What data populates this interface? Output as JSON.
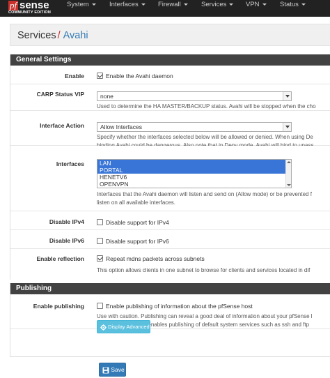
{
  "brand": {
    "logo_pf": "pf",
    "logo_sense": "sense",
    "edition": "COMMUNITY EDITION"
  },
  "nav": {
    "items": [
      {
        "label": "System"
      },
      {
        "label": "Interfaces"
      },
      {
        "label": "Firewall"
      },
      {
        "label": "Services"
      },
      {
        "label": "VPN"
      },
      {
        "label": "Status"
      }
    ]
  },
  "breadcrumb": {
    "parent": "Services",
    "separator": "/",
    "current": "Avahi"
  },
  "general": {
    "heading": "General Settings",
    "enable": {
      "label": "Enable",
      "text": "Enable the Avahi daemon",
      "checked": true
    },
    "carp": {
      "label": "CARP Status VIP",
      "value": "none",
      "help": "Used to determine the HA MASTER/BACKUP status. Avahi will be stopped when the cho"
    },
    "interface_action": {
      "label": "Interface Action",
      "value": "Allow Interfaces",
      "help1": "Specify whether the interfaces selected below will be allowed or denied. When using De",
      "help2": "binding Avahi could be dangerous. Also note that in Deny mode, Avahi will bind to unass"
    },
    "interfaces": {
      "label": "Interfaces",
      "options": [
        {
          "label": "LAN",
          "selected": true
        },
        {
          "label": "PORTAL",
          "selected": true
        },
        {
          "label": "HENETV6",
          "selected": false
        },
        {
          "label": "OPENVPN",
          "selected": false
        }
      ],
      "help1": "Interfaces that the Avahi daemon will listen and send on (Allow mode) or be prevented f",
      "help2": "listen on all available interfaces."
    },
    "disable_ipv4": {
      "label": "Disable IPv4",
      "text": "Disable support for IPv4",
      "checked": false
    },
    "disable_ipv6": {
      "label": "Disable IPv6",
      "text": "Disable support for IPv6",
      "checked": false
    },
    "reflection": {
      "label": "Enable reflection",
      "text": "Repeat mdns packets across subnets",
      "checked": true,
      "help": "This option allows clients in one subnet to browse for clients and services located in dif"
    }
  },
  "publishing": {
    "heading": "Publishing",
    "enable_publishing": {
      "label": "Enable publishing",
      "text": "Enable publishing of information about the pfSense host",
      "checked": false,
      "help1": "Use with caution. Publishing can reveal a good deal of information about your pfSense l",
      "help2": "Note that this option enables publishing of default system services such as ssh and ftp"
    },
    "advanced_button": "Display Advanced"
  },
  "save_button": "Save",
  "colors": {
    "navbar": "#222222",
    "panel_heading": "#424242",
    "link": "#337ab7",
    "brand_red": "#c9302c",
    "info_button": "#5bc0de",
    "primary_button": "#337ab7"
  }
}
